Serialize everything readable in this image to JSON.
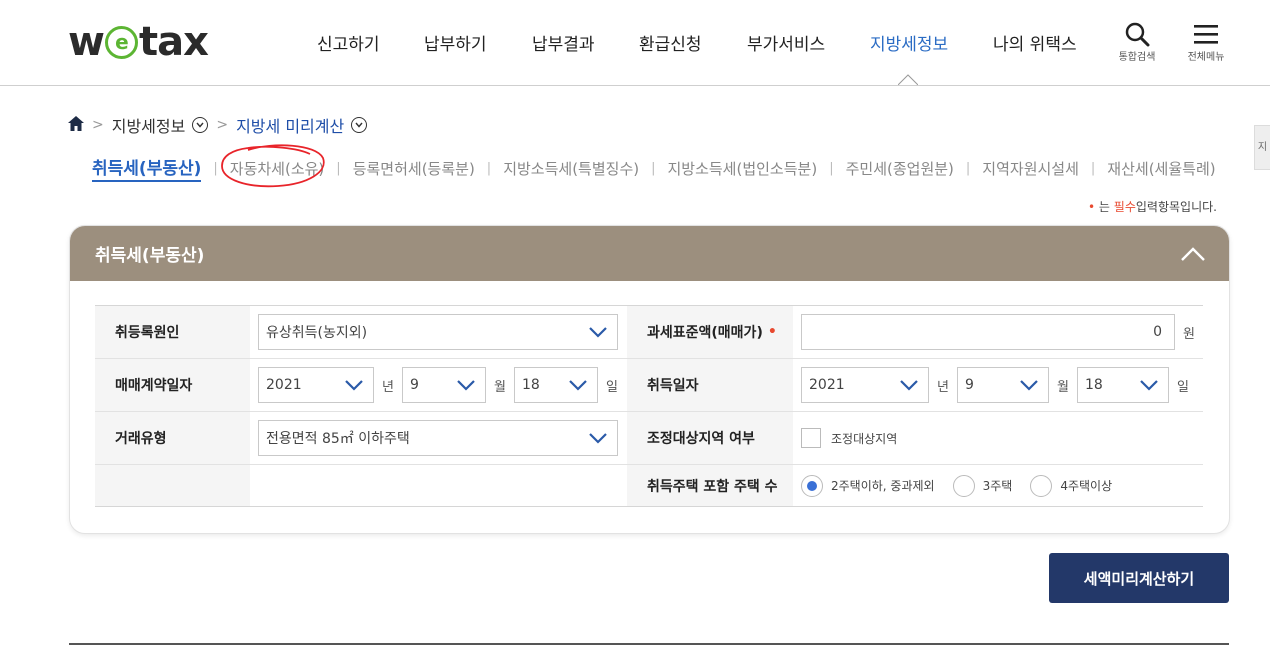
{
  "header": {
    "logo": "wetax",
    "nav": [
      "신고하기",
      "납부하기",
      "납부결과",
      "환급신청",
      "부가서비스",
      "지방세정보",
      "나의 위택스"
    ],
    "active_nav": "지방세정보",
    "search_label": "통합검색",
    "menu_label": "전체메뉴"
  },
  "side_tab": "지",
  "breadcrumb": {
    "home_icon": "home-icon",
    "level1": "지방세정보",
    "level2": "지방세 미리계산"
  },
  "tabs": [
    "취득세(부동산)",
    "자동차세(소유)",
    "등록면허세(등록분)",
    "지방소득세(특별징수)",
    "지방소득세(법인소득분)",
    "주민세(종업원분)",
    "지역자원시설세",
    "재산세(세율특례)"
  ],
  "active_tab": "취득세(부동산)",
  "required_note": {
    "dot": "•",
    "prefix": "는",
    "must": "필수",
    "suffix": "입력항목입니다."
  },
  "panel": {
    "title": "취득세(부동산)",
    "colors": {
      "header_bg": "#9c8f7e",
      "accent": "#2864c0",
      "button": "#233869",
      "required": "#e8492f"
    }
  },
  "form": {
    "cause_label": "취등록원인",
    "cause_value": "유상취득(농지외)",
    "base_label": "과세표준액(매매가)",
    "base_required": "•",
    "base_value": "0",
    "base_unit": "원",
    "contract_label": "매매계약일자",
    "contract_year": "2021",
    "contract_month": "9",
    "contract_day": "18",
    "unit_year": "년",
    "unit_month": "월",
    "unit_day": "일",
    "acq_label": "취득일자",
    "acq_year": "2021",
    "acq_month": "9",
    "acq_day": "18",
    "trade_label": "거래유형",
    "trade_value": "전용면적 85㎡ 이하주택",
    "region_label": "조정대상지역 여부",
    "region_option": "조정대상지역",
    "region_checked": false,
    "houses_label": "취득주택 포함 주택 수",
    "houses_options": [
      "2주택이하, 중과제외",
      "3주택",
      "4주택이상"
    ],
    "houses_selected": "2주택이하, 중과제외"
  },
  "calc_button": "세액미리계산하기"
}
